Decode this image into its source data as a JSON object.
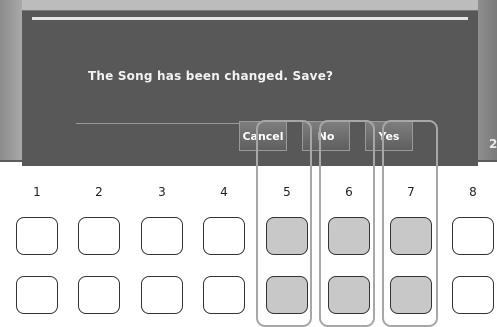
{
  "dialog": {
    "message": "The Song has been changed. Save?",
    "buttons": {
      "cancel": "Cancel",
      "no": "No",
      "yes": "Yes"
    }
  },
  "screen_right_edge_label": "2",
  "panel": {
    "column_numbers": [
      "1",
      "2",
      "3",
      "4",
      "5",
      "6",
      "7",
      "8"
    ],
    "highlighted_columns": [
      "5",
      "6",
      "7"
    ]
  },
  "colors": {
    "dialog_bg": "#585858",
    "highlighted_key": "#c8c8c8",
    "plain_key": "#ffffff",
    "highlight_frame": "#a7a7a7"
  }
}
